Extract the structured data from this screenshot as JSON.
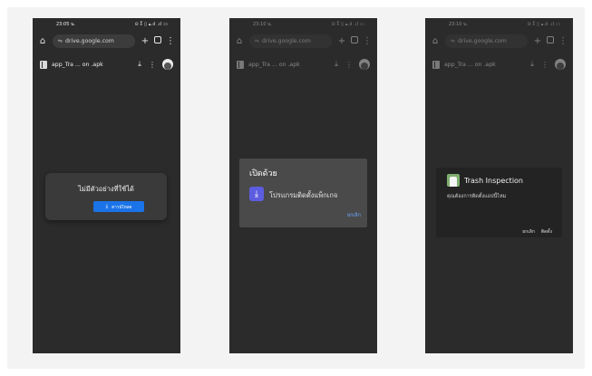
{
  "screens": [
    {
      "status": {
        "time": "23:05 น.",
        "icons": "⊙ ⁑ ▯ ▴.ıl .ıl ▭"
      },
      "url": "drive.google.com",
      "file": {
        "name": "app_Tra ... on .apk"
      },
      "dialog": {
        "message": "ไม่มีตัวอย่างที่ใช้ได้",
        "button": "ดาวน์โหลด"
      }
    },
    {
      "status": {
        "time": "23:10 น.",
        "icons": "⊙ ⁑ ▯ ▴.ıl .ıl ▭"
      },
      "url": "drive.google.com",
      "file": {
        "name": "app_Tra ... on .apk"
      },
      "dialog": {
        "title": "เปิดด้วย",
        "app_name": "โปรแกรมติดตั้งแพ็กเกจ",
        "cancel": "ยกเลิก"
      }
    },
    {
      "status": {
        "time": "23:10 น.",
        "icons": "⊙ ⁑ ▯ ▴.ıl .ıl ▭"
      },
      "url": "drive.google.com",
      "file": {
        "name": "app_Tra ... on .apk"
      },
      "dialog": {
        "app_title": "Trash Inspection",
        "question": "คุณต้องการติดตั้งแอปนี้ไหม",
        "cancel": "ยกเลิก",
        "install": "ติดตั้ง"
      }
    }
  ],
  "icons": {
    "home": "home-icon",
    "tune": "tune-icon",
    "new_tab": "plus-icon",
    "tabs": "tab-switcher-icon",
    "menu": "more-vert-icon",
    "file": "file-icon",
    "download": "download-icon",
    "avatar": "avatar"
  },
  "colors": {
    "accent": "#1a73e8",
    "installer": "#5c5ce0",
    "link": "#6fa8ff"
  }
}
